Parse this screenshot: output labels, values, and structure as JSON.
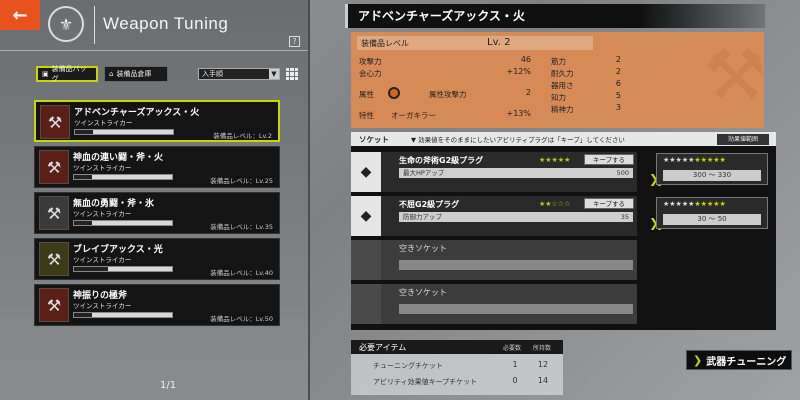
{
  "header": {
    "back_icon": "←",
    "title": "Weapon Tuning",
    "help": "?"
  },
  "filters": {
    "equipped_bag": "装備品バッグ",
    "equipped_warehouse": "装備品倉庫",
    "sort_label": "入手順",
    "sort_arrow": "▼"
  },
  "weapons": [
    {
      "name": "アドベンチャーズアックス・火",
      "type": "ツインストライカー",
      "level": "装備品レベル：Lv.2",
      "progress": 0.18,
      "element": "fire",
      "selected": true
    },
    {
      "name": "神血の連い闘・斧・火",
      "type": "ツインストライカー",
      "level": "装備品レベル：Lv.25",
      "progress": 0.18,
      "element": "fire",
      "selected": false
    },
    {
      "name": "無血の勇闘・斧・氷",
      "type": "ツインストライカー",
      "level": "装備品レベル：Lv.35",
      "progress": 0.18,
      "element": "ice",
      "selected": false
    },
    {
      "name": "ブレイブアックス・光",
      "type": "ツインストライカー",
      "level": "装備品レベル：Lv.40",
      "progress": 0.35,
      "element": "light",
      "selected": false
    },
    {
      "name": "神振りの極斧",
      "type": "ツインストライカー",
      "level": "装備品レベル：Lv.50",
      "progress": 0.18,
      "element": "fire",
      "selected": false
    }
  ],
  "pager": "1/1",
  "detail": {
    "title": "アドベンチャーズアックス・火",
    "level_label": "装備品レベル",
    "level_value": "Lv. 2",
    "attack_label": "攻撃力",
    "attack_value": "46",
    "crit_label": "会心力",
    "crit_value": "+12%",
    "element_label": "属性",
    "element_attack_label": "属性攻撃力",
    "element_attack_value": "2",
    "trait_label": "特性",
    "trait_name": "オーガキラー",
    "trait_value": "+13%",
    "right_stats": [
      {
        "label": "筋力",
        "value": "2"
      },
      {
        "label": "耐久力",
        "value": "2"
      },
      {
        "label": "器用さ",
        "value": "6"
      },
      {
        "label": "知力",
        "value": "5"
      },
      {
        "label": "精神力",
        "value": "3"
      }
    ]
  },
  "sockets": {
    "label": "ソケット",
    "note": "▼ 効果値をそのままにしたいアビリティプラグは「キープ」してください",
    "effect_list_button": "効果値範囲",
    "keep_label": "キープする",
    "empty_label": "空きソケット",
    "items": [
      {
        "name": "生命の斧術G2級プラグ",
        "stars": "★★★★★",
        "effect": "最大HPアップ",
        "effect_value": "500",
        "range_stars_dim": "★★★★★",
        "range_stars_hl": "★★★★★",
        "range": "300 ～ 330"
      },
      {
        "name": "不屈G2級プラグ",
        "stars": "★★☆☆☆",
        "effect": "防御力アップ",
        "effect_value": "35",
        "range_stars_dim": "★★★★★",
        "range_stars_hl": "★★★★★",
        "range": "30 ～ 50"
      }
    ]
  },
  "required": {
    "title": "必要アイテム",
    "col_needed": "必要数",
    "col_owned": "所持数",
    "rows": [
      {
        "name": "チューニングチケット",
        "needed": "1",
        "owned": "12"
      },
      {
        "name": "アビリティ効果値キープチケット",
        "needed": "0",
        "owned": "14"
      }
    ]
  },
  "tune_button": "武器チューニング"
}
